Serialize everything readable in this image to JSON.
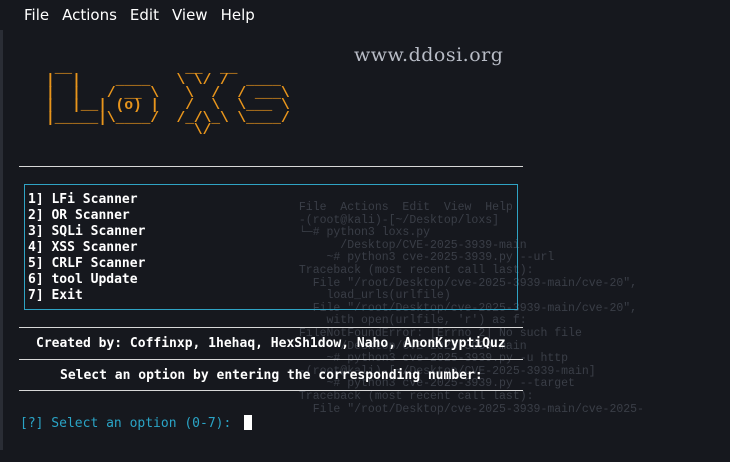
{
  "menubar": {
    "items": [
      "File",
      "Actions",
      "Edit",
      "View",
      "Help"
    ]
  },
  "watermark": "www.ddosi.org",
  "logo_text": "LoXs",
  "menu": {
    "items": [
      "1] LFi Scanner",
      "2] OR Scanner",
      "3] SQLi Scanner",
      "4] XSS Scanner",
      "5] CRLF Scanner",
      "6] tool Update",
      "7] Exit"
    ]
  },
  "credits": "Created by: Coffinxp, 1hehaq, HexSh1dow, Naho, AnonKryptiQuz",
  "instruction": "Select an option by entering the corresponding number:",
  "prompt": "[?] Select an option (0-7):",
  "colors": {
    "background": "#16181e",
    "logo": "#e8951c",
    "accent": "#2fa3c4",
    "text": "#ffffff"
  }
}
